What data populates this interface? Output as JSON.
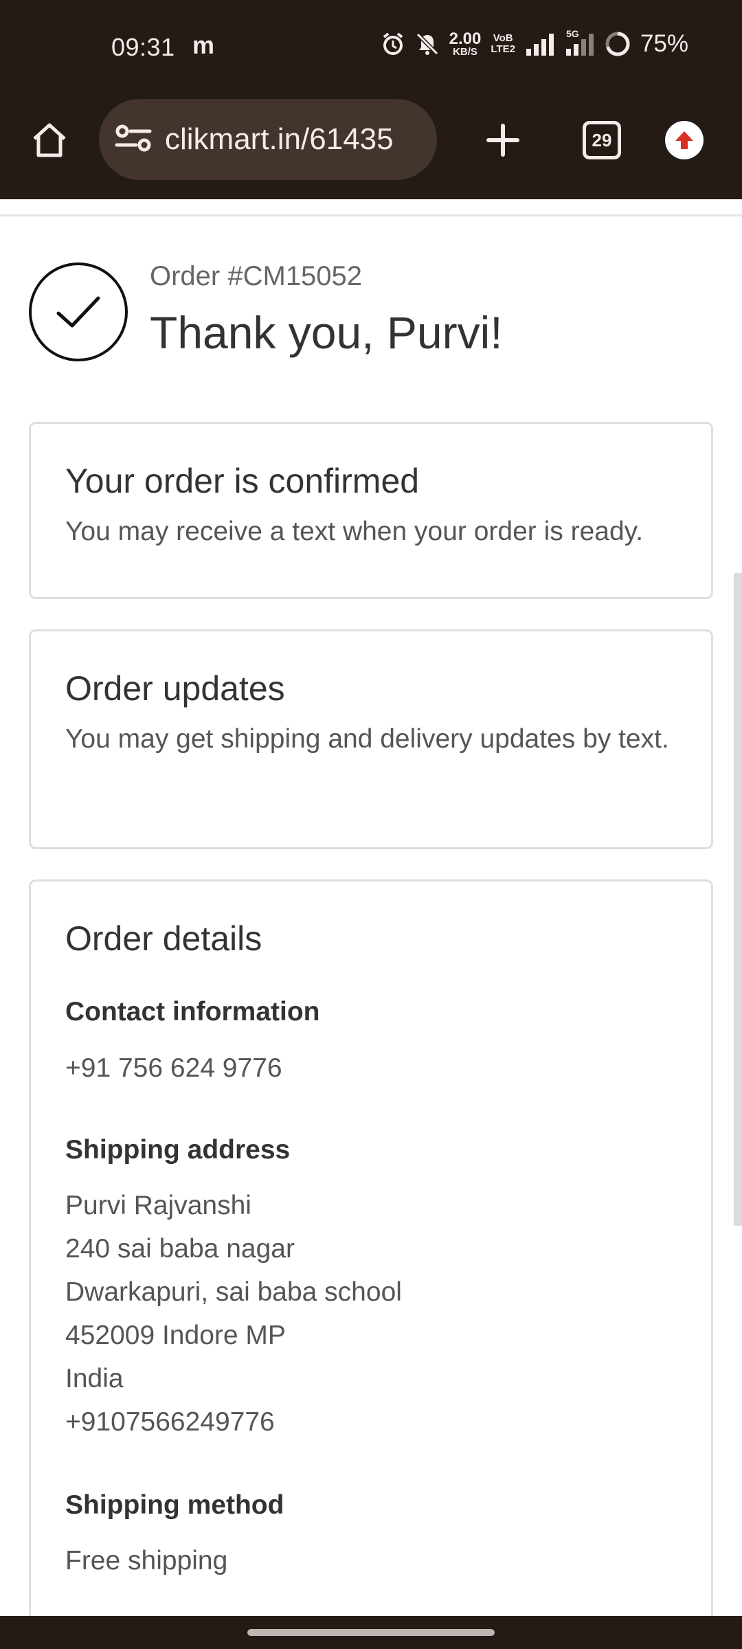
{
  "status_bar": {
    "time": "09:31",
    "notification_app": "m",
    "net_speed_value": "2.00",
    "net_speed_unit": "KB/S",
    "volte_top": "VoB",
    "volte_bottom": "LTE2",
    "network_5g": "5G",
    "battery": "75%"
  },
  "browser": {
    "url": "clikmart.in/61435",
    "tab_count": "29",
    "colors": {
      "bar": "#241b17",
      "url_pill": "#43342e",
      "update_icon": "#d93025"
    }
  },
  "confirmation": {
    "order_number": "Order #CM15052",
    "thank_you": "Thank you, Purvi!"
  },
  "confirmed_card": {
    "title": "Your order is confirmed",
    "text": "You may receive a text when your order is ready."
  },
  "updates_card": {
    "title": "Order updates",
    "text": "You may get shipping and delivery updates by text."
  },
  "details_card": {
    "title": "Order details",
    "contact_label": "Contact information",
    "contact_value": "+91 756 624 9776",
    "shipping_label": "Shipping address",
    "address_lines": [
      "Purvi Rajvanshi",
      "240 sai baba nagar",
      "Dwarkapuri, sai baba school",
      "452009 Indore MP",
      "India",
      "+9107566249776"
    ],
    "method_label": "Shipping method",
    "method_value": "Free shipping"
  }
}
